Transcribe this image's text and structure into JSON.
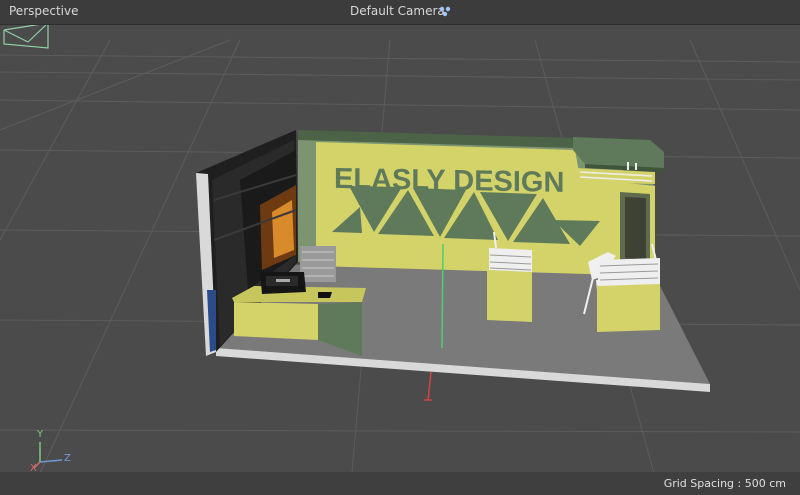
{
  "viewport": {
    "view_name": "Perspective",
    "camera_name": "Default Camera",
    "grid_spacing": "Grid Spacing : 500 cm",
    "axes": {
      "y": "Y",
      "z": "Z",
      "x": "X"
    }
  },
  "booth": {
    "brand_text": "ELASLY DESIGN"
  },
  "colors": {
    "background": "#4b4b4b",
    "grid_line": "#5a5a5a",
    "booth_yellow": "#d4d36a",
    "booth_green": "#5f7a5b",
    "floor": "#7a7a7a",
    "floor_edge": "#d9d9d9"
  },
  "icons": {
    "camera_dots": "camera-dots-icon",
    "axis_gizmo": "axis-gizmo-icon"
  }
}
